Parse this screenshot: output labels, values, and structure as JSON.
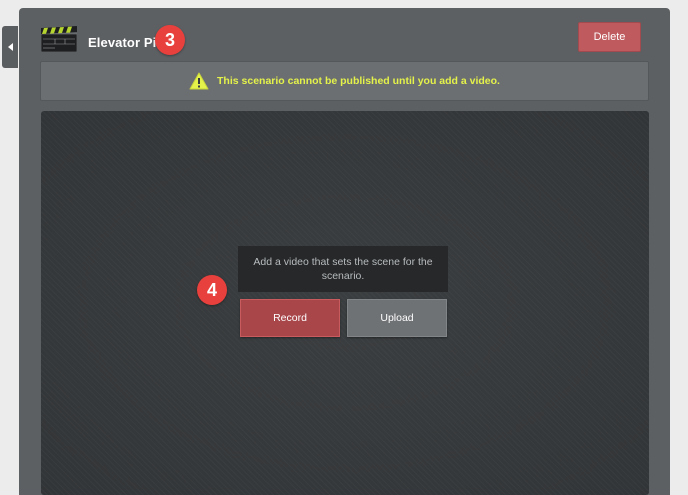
{
  "scenario": {
    "title": "Elevator Pitch",
    "icon": "clapperboard-icon"
  },
  "header": {
    "delete_label": "Delete"
  },
  "warning": {
    "icon": "warning-triangle-icon",
    "text": "This scenario cannot be published until you add a video."
  },
  "video": {
    "prompt": "Add a video that sets the scene for the scenario.",
    "record_label": "Record",
    "upload_label": "Upload"
  },
  "annotations": {
    "step_3": "3",
    "step_4": "4"
  },
  "colors": {
    "panel": "#5d6063",
    "delete": "#bf5a5e",
    "record": "#a8464a",
    "upload": "#6f7275",
    "warning_text": "#e4f24a",
    "badge": "#e8403c"
  }
}
